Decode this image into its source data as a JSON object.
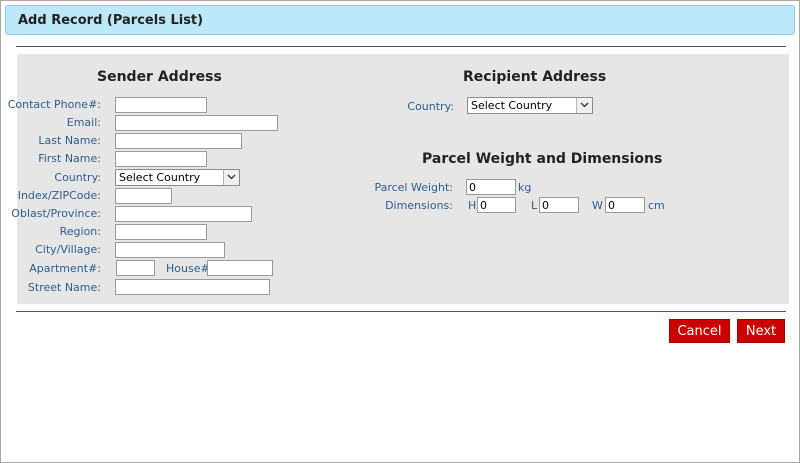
{
  "dialog": {
    "title": "Add Record (Parcels List)"
  },
  "sender": {
    "heading": "Sender Address",
    "contact_phone": {
      "label": "Contact Phone#:",
      "value": ""
    },
    "email": {
      "label": "Email:",
      "value": ""
    },
    "last_name": {
      "label": "Last Name:",
      "value": ""
    },
    "first_name": {
      "label": "First Name:",
      "value": ""
    },
    "country": {
      "label": "Country:",
      "selected": "Select Country"
    },
    "zip": {
      "label": "Index/ZIPCode:",
      "value": ""
    },
    "oblast": {
      "label": "Oblast/Province:",
      "value": ""
    },
    "region": {
      "label": "Region:",
      "value": ""
    },
    "city": {
      "label": "City/Village:",
      "value": ""
    },
    "apartment": {
      "label": "Apartment#:",
      "value": ""
    },
    "house": {
      "label": "House#:",
      "value": ""
    },
    "street": {
      "label": "Street Name:",
      "value": ""
    }
  },
  "recipient": {
    "heading": "Recipient Address",
    "country": {
      "label": "Country:",
      "selected": "Select Country"
    }
  },
  "parcel": {
    "heading": "Parcel Weight and Dimensions",
    "weight_label": "Parcel Weight:",
    "weight_value": "0",
    "weight_unit": "kg",
    "dimensions_label": "Dimensions:",
    "h_label": "H",
    "h_value": "0",
    "l_label": "L",
    "l_value": "0",
    "w_label": "W",
    "w_value": "0",
    "dim_unit": "cm"
  },
  "buttons": {
    "cancel": "Cancel",
    "next": "Next"
  },
  "colors": {
    "title_bg": "#bde8f9",
    "panel_bg": "#e6e6e6",
    "label": "#2d5d8b",
    "button": "#cc0000"
  },
  "icons": {
    "dropdown": "chevron-down-icon"
  }
}
